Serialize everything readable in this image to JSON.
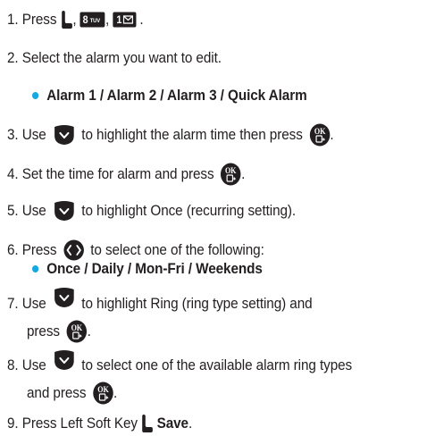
{
  "steps": {
    "s1": {
      "num": "1. Press",
      "comma1": ",",
      "comma2": ",",
      "end": ".",
      "key8_text": "8",
      "key8_sub": "TUV",
      "key1_text": "1"
    },
    "s2": {
      "text": "2. Select the alarm you want to edit."
    },
    "s2b": {
      "text": "Alarm 1 / Alarm 2 / Alarm 3 / Quick Alarm"
    },
    "s3": {
      "a": "3. Use",
      "b": "to highlight the alarm time then press",
      "end": "."
    },
    "s4": {
      "a": "4. Set the time for alarm and press",
      "end": "."
    },
    "s5": {
      "a": "5. Use",
      "b": "to highlight Once (recurring setting)."
    },
    "s6": {
      "a": "6. Press",
      "b": "to select one of the following:"
    },
    "s6b": {
      "text": "Once / Daily / Mon-Fri / Weekends"
    },
    "s7": {
      "a": "7. Use",
      "b": "to highlight Ring (ring type setting) and"
    },
    "s7c": {
      "a": "press",
      "end": "."
    },
    "s8": {
      "a": "8. Use",
      "b": "to select one of the available alarm ring types"
    },
    "s8c": {
      "a": "and press",
      "end": "."
    },
    "s9": {
      "a": "9. Press Left Soft Key",
      "b": "Save",
      "end": "."
    }
  },
  "ok_label": "OK",
  "colors": {
    "bullet": "#16a8e0",
    "key": "#231f20"
  }
}
